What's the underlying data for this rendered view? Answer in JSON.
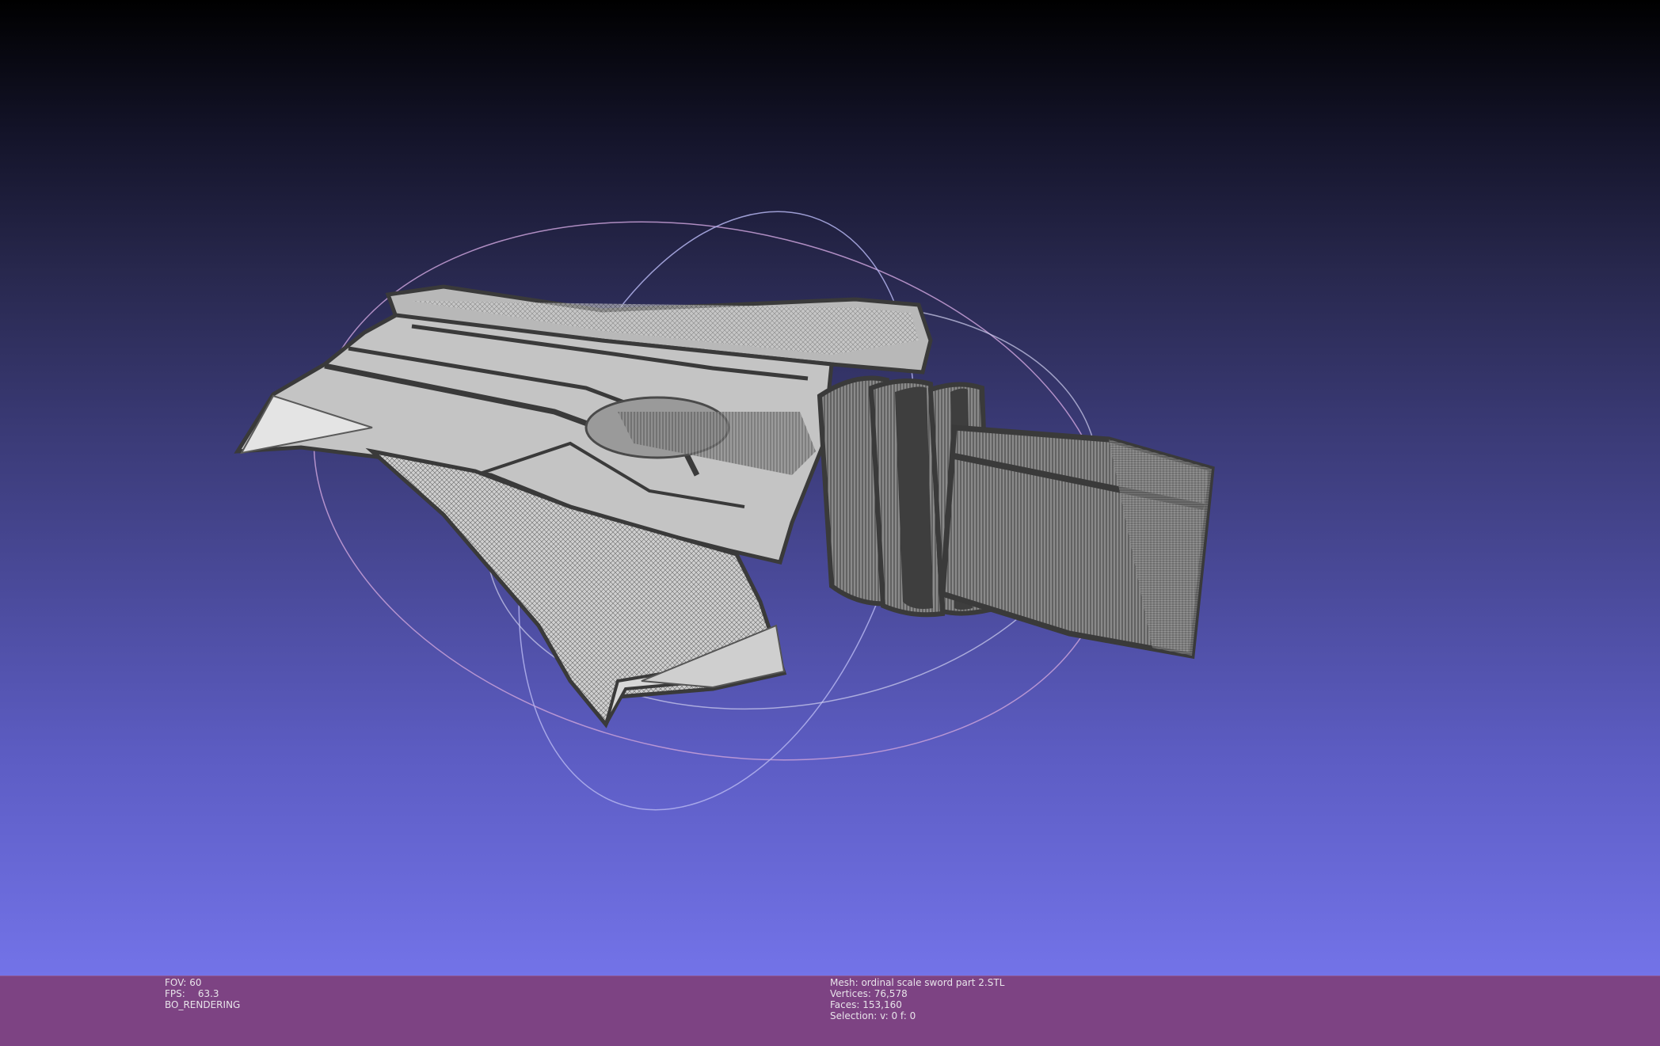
{
  "viewport": {
    "background_top": "#000000",
    "background_bottom": "#7373e8",
    "mesh_color": "#c9c9c9",
    "wire_color": "#4a4a4a"
  },
  "info_left": {
    "fov_label": "FOV:",
    "fov_value": "60",
    "fps_label": "FPS:",
    "fps_value": "63.3",
    "render_mode": "BO_RENDERING"
  },
  "info_right": {
    "mesh": "Mesh: ordinal scale sword part 2.STL",
    "vertices": "Vertices: 76,578",
    "faces": "Faces: 153,160",
    "selection": "Selection: v: 0 f: 0"
  },
  "infobar_color": "#7d4383"
}
